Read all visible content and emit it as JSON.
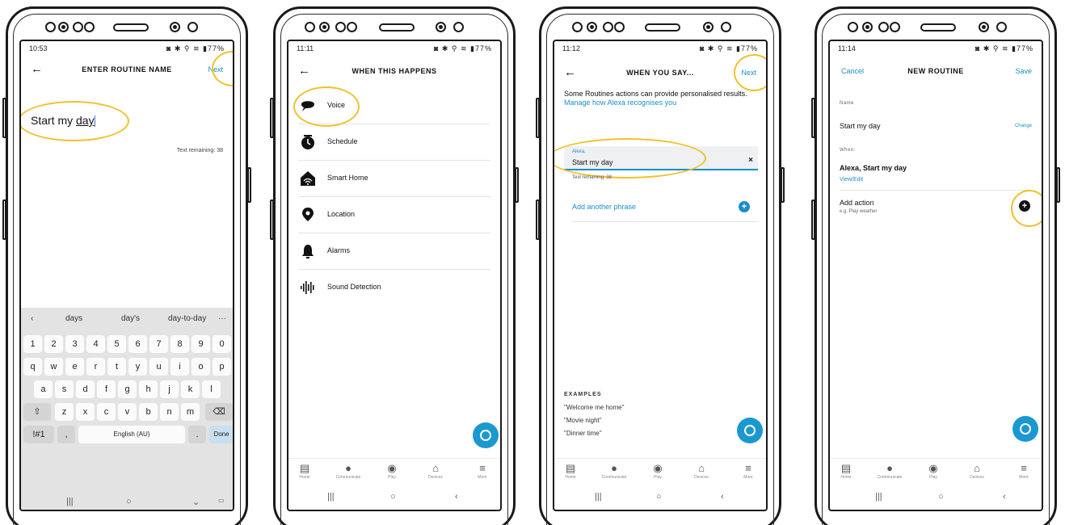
{
  "screens": [
    {
      "status_time": "10:53",
      "status_icons": "◙ ✱ ⚲ ≋ ▮77%",
      "title": "ENTER ROUTINE NAME",
      "action_right": "Next",
      "routine_name_prefix": "Start my ",
      "routine_name_word": "day",
      "text_remaining": "Text remaining: 38",
      "keyboard": {
        "suggestions": [
          "days",
          "day's",
          "day-to-day"
        ],
        "more": "···",
        "row1": [
          "1",
          "2",
          "3",
          "4",
          "5",
          "6",
          "7",
          "8",
          "9",
          "0"
        ],
        "row2": [
          "q",
          "w",
          "e",
          "r",
          "t",
          "y",
          "u",
          "i",
          "o",
          "p"
        ],
        "row3": [
          "a",
          "s",
          "d",
          "f",
          "g",
          "h",
          "j",
          "k",
          "l"
        ],
        "row4": [
          "z",
          "x",
          "c",
          "v",
          "b",
          "n",
          "m"
        ],
        "symbols_key": "!#1",
        "comma_key": ",",
        "space_key": "English (AU)",
        "period_key": ".",
        "done_key": "Done"
      }
    },
    {
      "status_time": "11:11",
      "status_icons": "◙ ✱ ⚲ ≋ ▮77%",
      "title": "WHEN THIS HAPPENS",
      "triggers": [
        "Voice",
        "Schedule",
        "Smart Home",
        "Location",
        "Alarms",
        "Sound Detection"
      ]
    },
    {
      "status_time": "11:12",
      "status_icons": "◙ ✱ ⚲ ≋ ▮77%",
      "title": "WHEN YOU SAY...",
      "action_right": "Next",
      "info_text": "Some Routines actions can provide personalised results.",
      "info_link": "Manage how Alexa recognises you",
      "phrase_label": "Alexa,",
      "phrase_value": "Start my day",
      "text_remaining": "Text remaining: 38",
      "add_phrase": "Add another phrase",
      "examples_heading": "EXAMPLES",
      "examples": [
        "\"Welcome me home\"",
        "\"Movie night\"",
        "\"Dinner time\""
      ]
    },
    {
      "status_time": "11:14",
      "status_icons": "◙ ✱ ⚲ ≋ ▮77%",
      "title": "NEW ROUTINE",
      "action_left": "Cancel",
      "action_right": "Save",
      "name_label": "Name",
      "name_value": "Start my day",
      "change_label": "Change",
      "when_label": "When:",
      "when_value": "Alexa, Start my day",
      "view_edit": "View/Edit",
      "add_action": "Add action",
      "add_action_hint": "e.g. Play weather"
    }
  ],
  "bottom_nav": [
    "Home",
    "Communicate",
    "Play",
    "Devices",
    "More"
  ],
  "colors": {
    "accent": "#1a8ec9",
    "highlight": "#f1c12b",
    "fab": "#1a98d0"
  }
}
